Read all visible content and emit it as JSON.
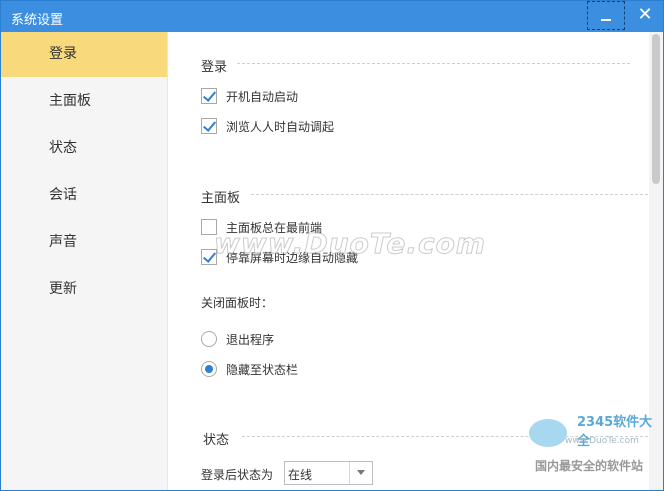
{
  "window": {
    "title": "系统设置",
    "minimize_icon": "minimize-icon",
    "close_icon": "close-icon",
    "close_glyph": "✕"
  },
  "sidebar": {
    "items": [
      {
        "label": "登录",
        "active": true
      },
      {
        "label": "主面板",
        "active": false
      },
      {
        "label": "状态",
        "active": false
      },
      {
        "label": "会话",
        "active": false
      },
      {
        "label": "声音",
        "active": false
      },
      {
        "label": "更新",
        "active": false
      }
    ]
  },
  "sections": {
    "login": {
      "title": "登录",
      "options": [
        {
          "label": "开机自动启动",
          "checked": true
        },
        {
          "label": "浏览人人时自动调起",
          "checked": true
        }
      ]
    },
    "main_panel": {
      "title": "主面板",
      "options": [
        {
          "label": "主面板总在最前端",
          "checked": false
        },
        {
          "label": "停靠屏幕时边缘自动隐藏",
          "checked": true
        }
      ],
      "close_label": "关闭面板时：",
      "close_options": [
        {
          "label": "退出程序",
          "selected": false
        },
        {
          "label": "隐藏至状态栏",
          "selected": true
        }
      ]
    },
    "status": {
      "title": "状态",
      "after_login_label": "登录后状态为",
      "selected_status": "在线"
    }
  },
  "watermark": {
    "text": "www.DuoTe.com"
  },
  "logo": {
    "brand": "2345软件大全",
    "url": "www.DuoTe.com",
    "slogan": "国内最安全的软件站"
  },
  "colors": {
    "titlebar": "#3c8fe0",
    "active_nav": "#f8da7c",
    "accent": "#2f7fd2"
  }
}
